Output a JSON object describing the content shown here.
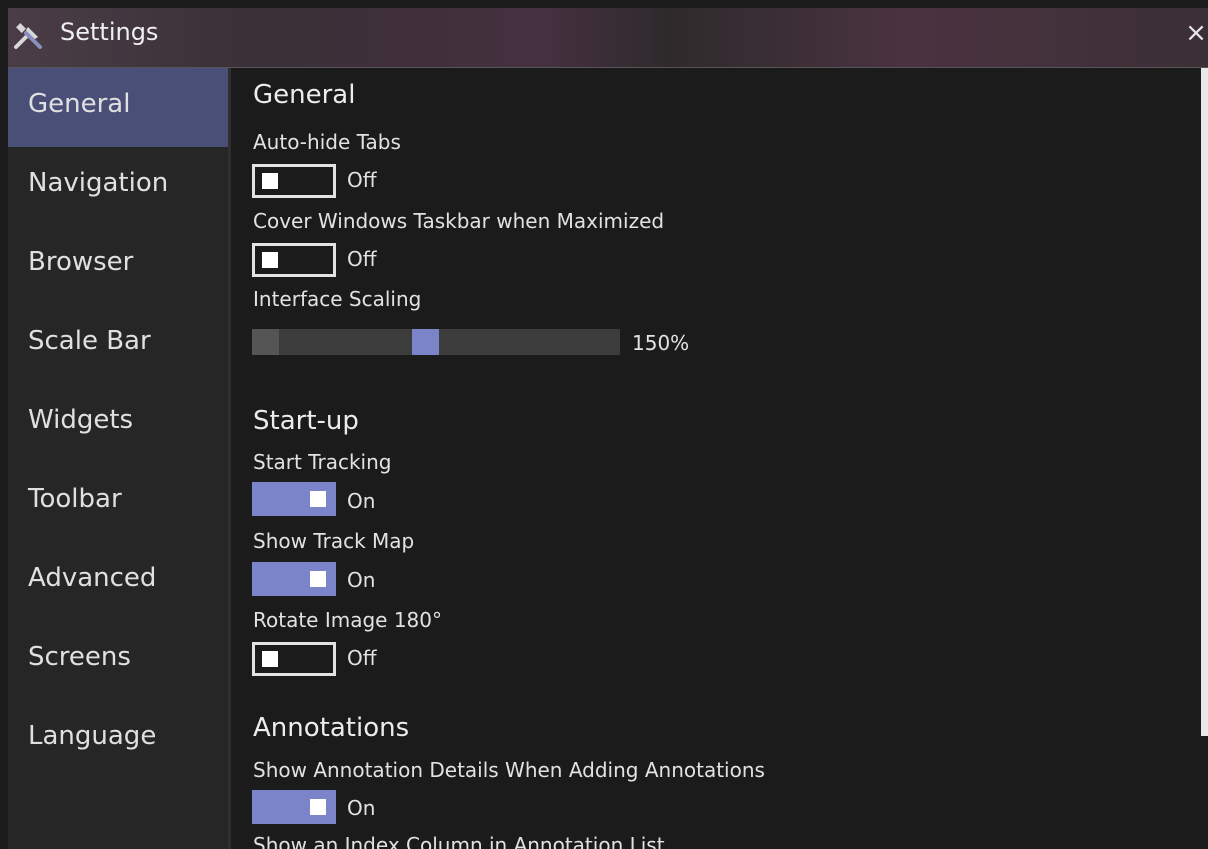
{
  "window": {
    "title": "Settings",
    "close_glyph": "×"
  },
  "icons": {
    "title": "tools-icon",
    "close": "close-icon"
  },
  "sidebar": {
    "items": [
      {
        "label": "General",
        "active": true
      },
      {
        "label": "Navigation"
      },
      {
        "label": "Browser"
      },
      {
        "label": "Scale Bar"
      },
      {
        "label": "Widgets"
      },
      {
        "label": "Toolbar"
      },
      {
        "label": "Advanced"
      },
      {
        "label": "Screens"
      },
      {
        "label": "Language"
      }
    ]
  },
  "general": {
    "heading": "General",
    "auto_hide_tabs": {
      "label": "Auto-hide Tabs",
      "state": "Off"
    },
    "cover_taskbar": {
      "label": "Cover Windows Taskbar when Maximized",
      "state": "Off"
    },
    "interface_scaling": {
      "label": "Interface Scaling",
      "value": "150%",
      "position_fraction": 0.47
    }
  },
  "startup": {
    "heading": "Start-up",
    "start_tracking": {
      "label": "Start Tracking",
      "state": "On"
    },
    "show_track_map": {
      "label": "Show Track Map",
      "state": "On"
    },
    "rotate_image": {
      "label": "Rotate Image 180°",
      "state": "Off"
    }
  },
  "annotations": {
    "heading": "Annotations",
    "show_details": {
      "label": "Show Annotation Details When Adding Annotations",
      "state": "On"
    },
    "index_column": {
      "label": "Show an Index Column in Annotation List"
    }
  },
  "colors": {
    "accent": "#7b84c8",
    "sidebar_active": "#4a4f78",
    "background": "#1b1b1b",
    "sidebar": "#262626"
  }
}
